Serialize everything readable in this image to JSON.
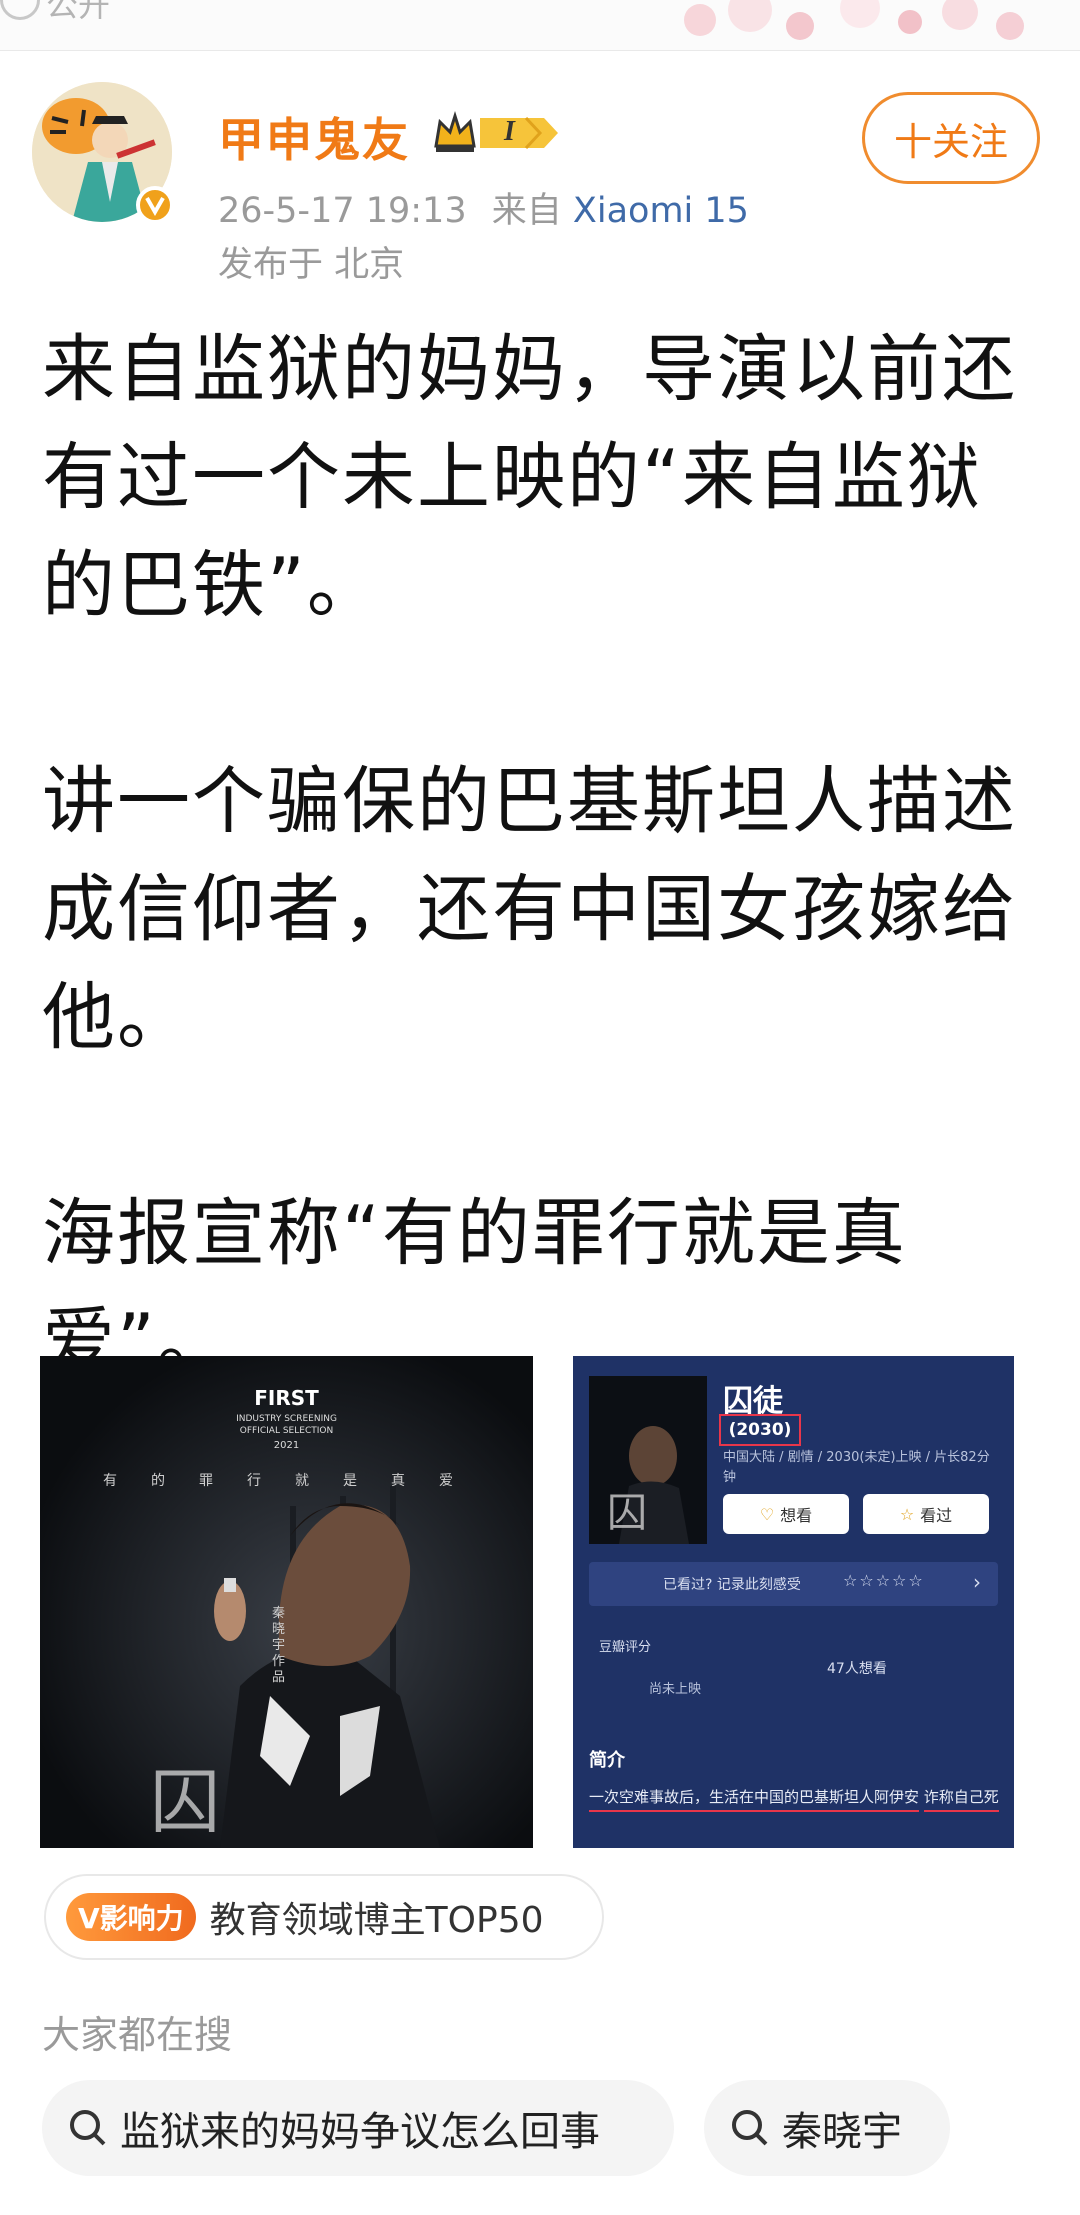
{
  "header": {
    "visibility_label": "公开",
    "username": "甲申鬼友",
    "level": "I",
    "timestamp": "26-5-17 19:13",
    "source_prefix": "来自",
    "device": "Xiaomi 15",
    "location": "发布于 北京",
    "follow_label": "十关注"
  },
  "post": {
    "paragraphs": [
      "来自监狱的妈妈，导演以前还有过一个未上映的“来自监狱的巴铁”。",
      "讲一个骗保的巴基斯坦人描述成信仰者，还有中国女孩嫁给他。",
      "海报宣称“有的罪行就是真爱”。"
    ]
  },
  "poster": {
    "festival": "FIRST",
    "selection_line1": "INDUSTRY SCREENING",
    "selection_line2": "OFFICIAL SELECTION",
    "year": "2021",
    "tagline": "有的罪行就是真爱",
    "director_credit": "秦晓宇 作品"
  },
  "movie_info": {
    "title": "囚徒",
    "year": "(2030)",
    "meta": "中国大陆 / 剧情 / 2030(未定)上映 / 片长82分钟",
    "want_button": "想看",
    "seen_button": "看过",
    "seen_prompt": "已看过? 记录此刻感受",
    "rating_label": "豆瓣评分",
    "rating_value": "尚未上映",
    "want_count": "47人想看",
    "synopsis_title": "简介",
    "synopsis_line1": "一次空难事故后，生活在中国的巴基斯坦人阿伊安",
    "synopsis_line2": "诈称自己死亡，以期从保险公司骗取险金，却因此"
  },
  "influence": {
    "tag": "V影响力",
    "text": "教育领域博主TOP50"
  },
  "trending": {
    "title": "大家都在搜",
    "chips": [
      "监狱来的妈妈争议怎么回事",
      "秦晓宇"
    ]
  }
}
